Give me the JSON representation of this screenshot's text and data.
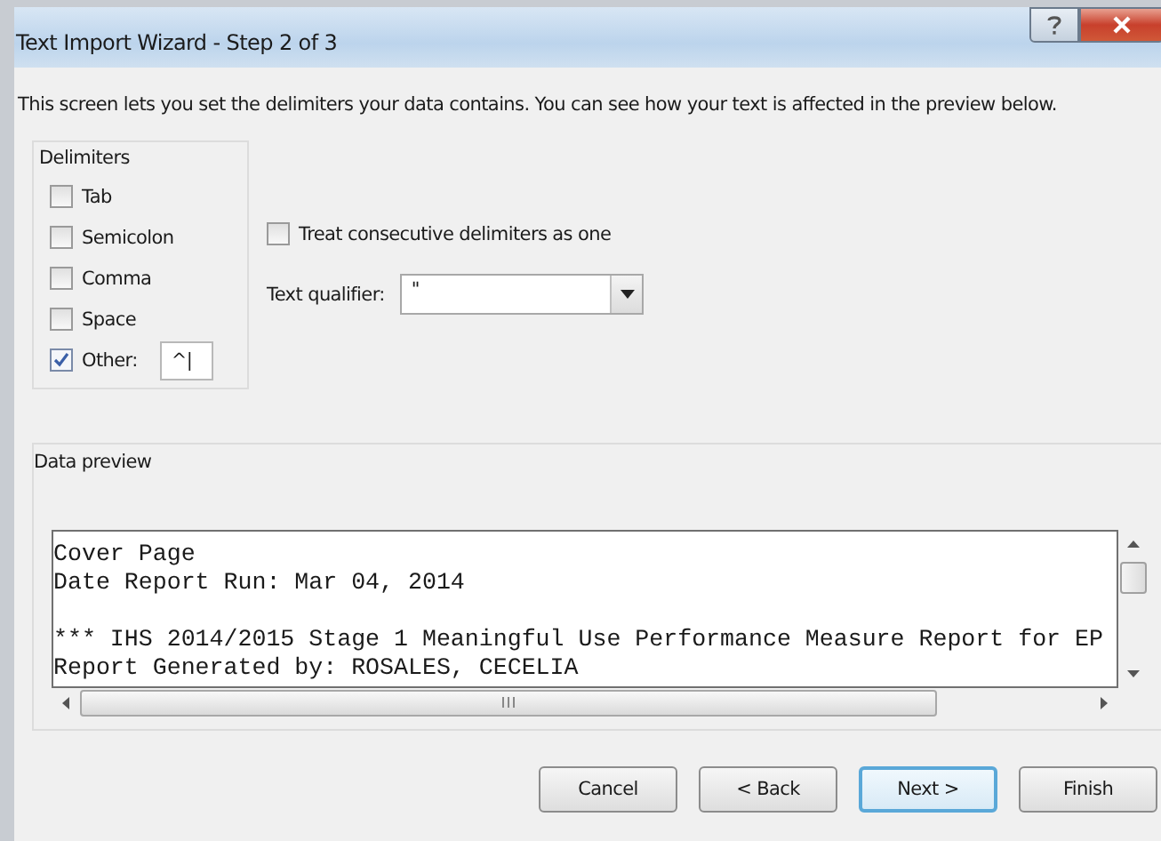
{
  "window": {
    "title": "Text Import Wizard - Step 2 of 3"
  },
  "description": "This screen lets you set the delimiters your data contains.  You can see how your text is affected in the preview below.",
  "delimiters": {
    "legend": "Delimiters",
    "items": [
      {
        "label": "Tab",
        "checked": false
      },
      {
        "label": "Semicolon",
        "checked": false
      },
      {
        "label": "Comma",
        "checked": false
      },
      {
        "label": "Space",
        "checked": false
      },
      {
        "label": "Other:",
        "checked": true
      }
    ],
    "other_value": "^|"
  },
  "treat_consecutive": {
    "label": "Treat consecutive delimiters as one",
    "checked": false
  },
  "text_qualifier": {
    "label": "Text qualifier:",
    "value": "\""
  },
  "data_preview": {
    "legend": "Data preview",
    "lines": [
      {
        "text": "Cover Page",
        "gap_before": false
      },
      {
        "text": "Date Report Run: Mar 04, 2014",
        "gap_before": false
      },
      {
        "text": "*** IHS 2014/2015 Stage 1 Meaningful Use Performance Measure Report for EP",
        "gap_before": true
      },
      {
        "text": "Report Generated by: ROSALES, CECELIA",
        "gap_before": false
      }
    ]
  },
  "buttons": [
    {
      "label": "Cancel",
      "focused": false
    },
    {
      "label": "< Back",
      "focused": false
    },
    {
      "label": "Next >",
      "focused": true
    },
    {
      "label": "Finish",
      "focused": false
    }
  ]
}
